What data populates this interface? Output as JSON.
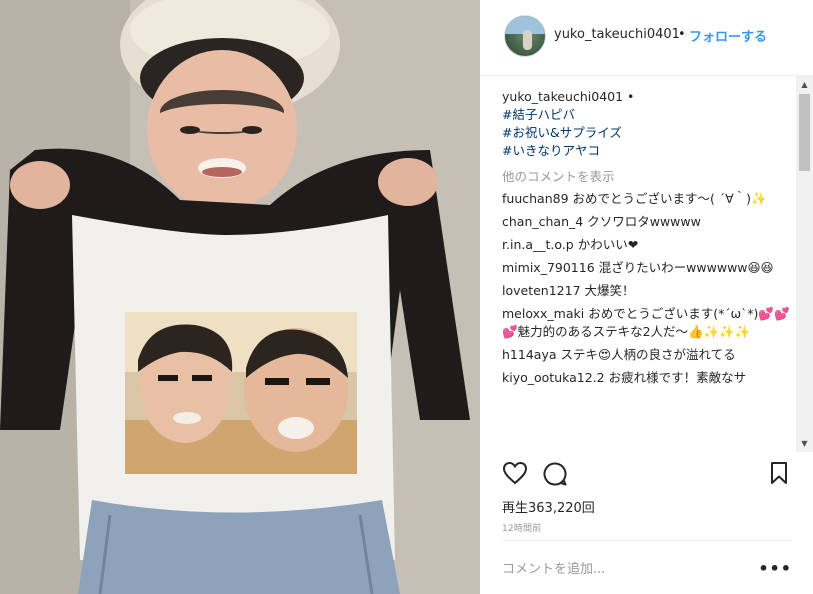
{
  "post": {
    "username": "yuko_takeuchi0401",
    "separator": "•",
    "follow_label": "フォローする"
  },
  "caption": {
    "username": "yuko_takeuchi0401",
    "separator": "•",
    "hashtags": [
      "#結子ハピバ",
      "#お祝い&サプライズ",
      "#いきなりアヤコ"
    ]
  },
  "load_more_label": "他のコメントを表示",
  "comments": [
    {
      "user": "fuuchan89",
      "text": "おめでとうございます〜( ´∀｀)✨"
    },
    {
      "user": "chan_chan_4",
      "text": "クソワロタwwwww"
    },
    {
      "user": "r.in.a__t.o.p",
      "text": "かわいい❤"
    },
    {
      "user": "mimix_790116",
      "text": "混ざりたいわーwwwwww😆😆"
    },
    {
      "user": "loveten1217",
      "text": "大爆笑！"
    },
    {
      "user": "meloxx_maki",
      "text": "おめでとうございます(*´ω`*)💕💕💕魅力的のあるステキな2人だ〜👍✨✨✨"
    },
    {
      "user": "h114aya",
      "text": "ステキ😍人柄の良さが溢れてる"
    },
    {
      "user": "kiyo_ootuka12.2",
      "text": "お疲れ様です！素敵なサ"
    }
  ],
  "icons": {
    "like": "heart-icon",
    "comment": "comment-icon",
    "save": "bookmark-icon",
    "more": "more-dots-icon",
    "scroll_up": "scroll-up-arrow",
    "scroll_down": "scroll-down-arrow"
  },
  "views_label": "再生363,220回",
  "timestamp": "12時間前",
  "add_comment": {
    "placeholder": "コメントを追加...",
    "value": ""
  },
  "more_options_glyph": "•••",
  "colors": {
    "link": "#003569",
    "follow": "#3897f0",
    "muted": "#999999",
    "text": "#262626"
  }
}
